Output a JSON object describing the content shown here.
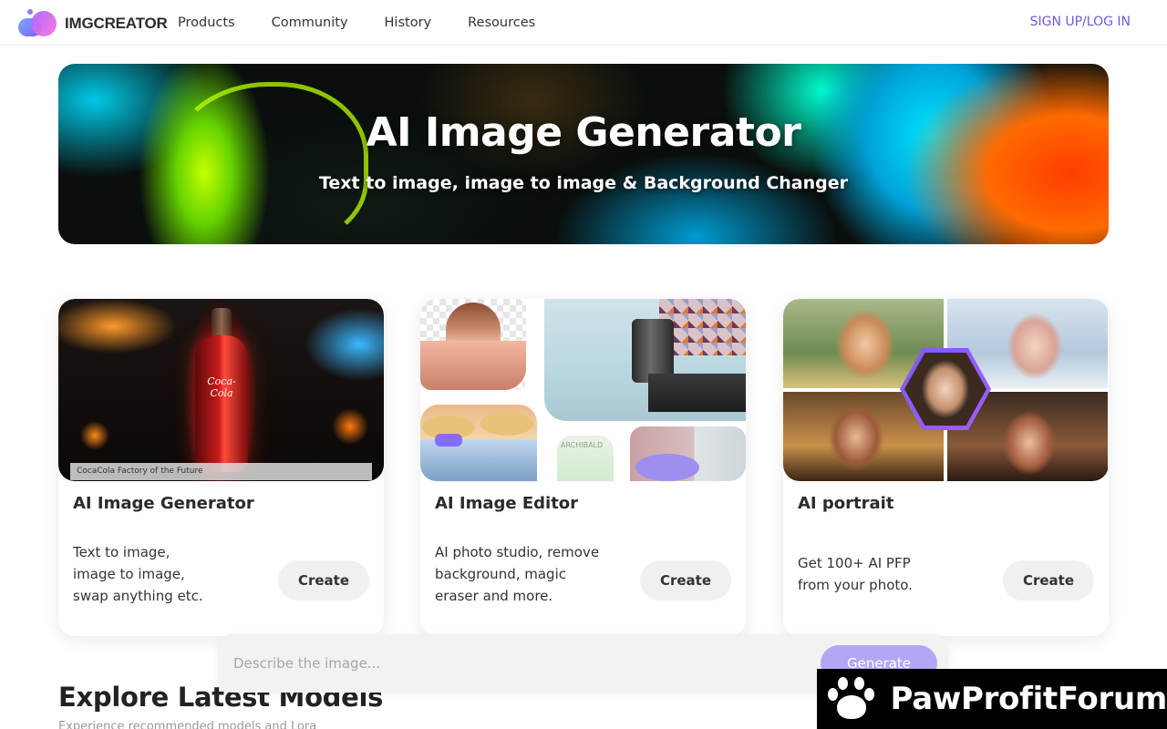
{
  "nav": {
    "brand": "IMGCREATOR",
    "links": [
      "Products",
      "Community",
      "History",
      "Resources"
    ],
    "signup": "SIGN UP/LOG IN",
    "accent_color": "#7457e0"
  },
  "hero": {
    "title": "AI Image Generator",
    "subtitle": "Text to image, image to image & Background Changer"
  },
  "cards": [
    {
      "title": "AI Image Generator",
      "description": [
        "Text to image,",
        "image to image,",
        "swap anything etc."
      ],
      "button": "Create",
      "caption": "CocaCola Factory of the Future",
      "bottle_label": "Coca-Cola"
    },
    {
      "title": "AI Image Editor",
      "description": [
        "AI photo studio, remove",
        "background, magic",
        "eraser and more."
      ],
      "button": "Create",
      "image_text": "ARCHIBALD"
    },
    {
      "title": "AI portrait",
      "description": [
        "Get 100+ AI PFP",
        "from your photo."
      ],
      "button": "Create"
    }
  ],
  "prompt": {
    "placeholder": "Describe the image...",
    "button": "Generate",
    "button_color": "#b5a6f5"
  },
  "explore": {
    "title": "Explore Latest Models",
    "subtitle": "Experience recommended models and Lora"
  },
  "watermark": {
    "text": "PawProfitForum",
    "icon": "paw-icon"
  }
}
